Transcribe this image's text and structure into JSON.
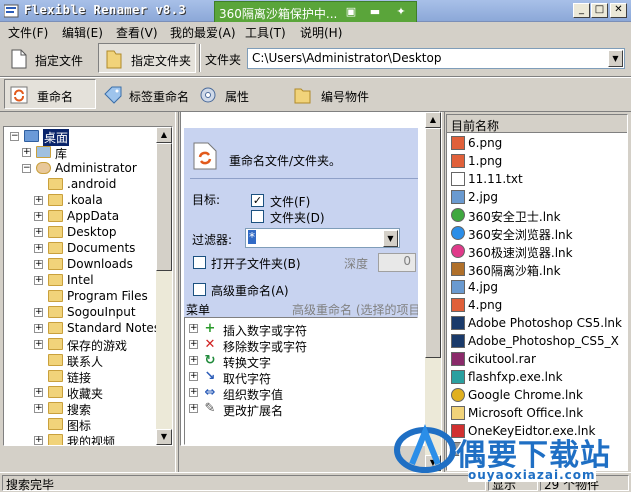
{
  "window": {
    "title": "Flexible Renamer v8.3"
  },
  "sandbox": {
    "text": "360隔离沙箱保护中..."
  },
  "menu": [
    "文件(F)",
    "编辑(E)",
    "查看(V)",
    "我的最爱(A)",
    "工具(T)",
    "说明(H)"
  ],
  "toolbar1": {
    "file_btn": "指定文件",
    "folder_btn": "指定文件夹",
    "path_label": "文件夹",
    "path_value": "C:\\Users\\Administrator\\Desktop"
  },
  "toolbar2": {
    "rename": "重命名",
    "tag_rename": "标签重命名",
    "properties": "属性",
    "number_items": "编号物件"
  },
  "tree": [
    {
      "label": "桌面",
      "level": 0,
      "expand": "−",
      "selected": true
    },
    {
      "label": "库",
      "level": 1,
      "expand": "+"
    },
    {
      "label": "Administrator",
      "level": 1,
      "expand": "−"
    },
    {
      "label": ".android",
      "level": 2,
      "expand": ""
    },
    {
      "label": ".koala",
      "level": 2,
      "expand": "+"
    },
    {
      "label": "AppData",
      "level": 2,
      "expand": "+"
    },
    {
      "label": "Desktop",
      "level": 2,
      "expand": "+"
    },
    {
      "label": "Documents",
      "level": 2,
      "expand": "+"
    },
    {
      "label": "Downloads",
      "level": 2,
      "expand": "+"
    },
    {
      "label": "Intel",
      "level": 2,
      "expand": "+"
    },
    {
      "label": "Program Files",
      "level": 2,
      "expand": ""
    },
    {
      "label": "SogouInput",
      "level": 2,
      "expand": "+"
    },
    {
      "label": "Standard Notes",
      "level": 2,
      "expand": "+"
    },
    {
      "label": "保存的游戏",
      "level": 2,
      "expand": "+"
    },
    {
      "label": "联系人",
      "level": 2,
      "expand": ""
    },
    {
      "label": "链接",
      "level": 2,
      "expand": ""
    },
    {
      "label": "收藏夹",
      "level": 2,
      "expand": "+"
    },
    {
      "label": "搜索",
      "level": 2,
      "expand": "+"
    },
    {
      "label": "图标",
      "level": 2,
      "expand": ""
    },
    {
      "label": "我的视频",
      "level": 2,
      "expand": "+"
    }
  ],
  "rename_panel": {
    "heading": "重命名文件/文件夹。",
    "target_label": "目标:",
    "files_label": "文件(F)",
    "files_checked": true,
    "folders_label": "文件夹(D)",
    "folders_checked": false,
    "filter_label": "过滤器:",
    "filter_value": "*",
    "subfolders_label": "打开子文件夹(B)",
    "depth_label": "深度",
    "depth_value": "0",
    "advanced_label": "高级重命名(A)",
    "menu_label": "菜单",
    "menu_hint": "高级重命名 (选择的项目"
  },
  "operations": [
    {
      "label": "插入数字或字符",
      "icon": "plus-icon"
    },
    {
      "label": "移除数字或字符",
      "icon": "cross-icon"
    },
    {
      "label": "转换文字",
      "icon": "convert-icon"
    },
    {
      "label": "取代字符",
      "icon": "replace-icon"
    },
    {
      "label": "组织数字值",
      "icon": "organize-icon"
    },
    {
      "label": "更改扩展名",
      "icon": "extension-icon"
    }
  ],
  "filelist": {
    "header": "目前名称",
    "files": [
      {
        "name": "6.png",
        "icon": "png"
      },
      {
        "name": "1.png",
        "icon": "png"
      },
      {
        "name": "11.11.txt",
        "icon": "txt"
      },
      {
        "name": "2.jpg",
        "icon": "jpg"
      },
      {
        "name": "360安全卫士.lnk",
        "icon": "360"
      },
      {
        "name": "360安全浏览器.lnk",
        "icon": "360se"
      },
      {
        "name": "360极速浏览器.lnk",
        "icon": "360ee"
      },
      {
        "name": "360隔离沙箱.lnk",
        "icon": "sandbox"
      },
      {
        "name": "4.jpg",
        "icon": "jpg"
      },
      {
        "name": "4.png",
        "icon": "png"
      },
      {
        "name": "Adobe Photoshop CS5.lnk",
        "icon": "ps"
      },
      {
        "name": "Adobe_Photoshop_CS5_X",
        "icon": "ps"
      },
      {
        "name": "cikutool.rar",
        "icon": "rar"
      },
      {
        "name": "flashfxp.exe.lnk",
        "icon": "fxp"
      },
      {
        "name": "Google Chrome.lnk",
        "icon": "chrome"
      },
      {
        "name": "Microsoft Office.lnk",
        "icon": "folder"
      },
      {
        "name": "OneKeyEidtor.exe.lnk",
        "icon": "onekey"
      },
      {
        "name": "...",
        "icon": "generic"
      }
    ]
  },
  "status": {
    "left": "搜索完毕",
    "mid": "显示",
    "right": "29 个物件"
  },
  "watermark": {
    "text": "偶要下载站",
    "url": "ouyaoxiazai.com"
  }
}
